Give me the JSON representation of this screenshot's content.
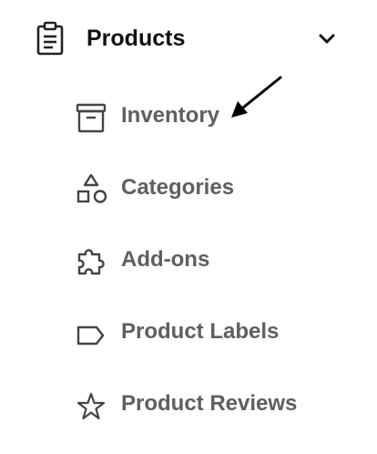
{
  "menu": {
    "section": {
      "title": "Products",
      "icon": "clipboard-icon",
      "expand_icon": "chevron-down-icon",
      "expanded": true
    },
    "items": [
      {
        "label": "Inventory",
        "icon": "archive-box-icon"
      },
      {
        "label": "Categories",
        "icon": "shapes-icon"
      },
      {
        "label": "Add-ons",
        "icon": "puzzle-icon"
      },
      {
        "label": "Product Labels",
        "icon": "tag-icon"
      },
      {
        "label": "Product Reviews",
        "icon": "star-icon"
      }
    ]
  },
  "annotation": {
    "icon": "arrow-pointer-icon",
    "target": "Inventory"
  },
  "colors": {
    "title_text": "#111111",
    "item_text": "#5f5f5f",
    "item_icon": "#444444",
    "arrow": "#000000"
  }
}
